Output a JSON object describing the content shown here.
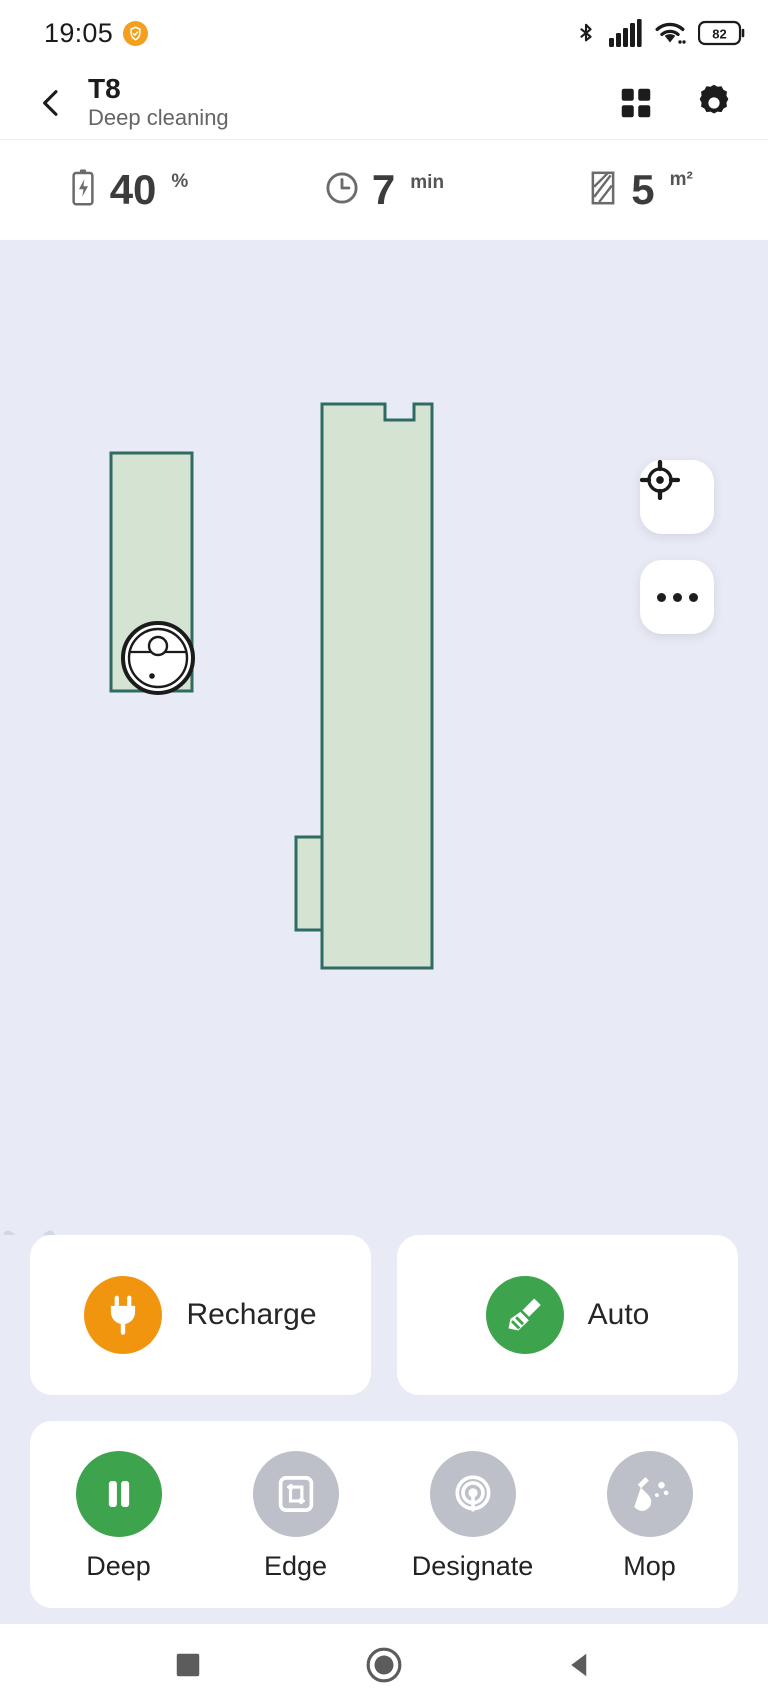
{
  "status_bar": {
    "time": "19:05",
    "badge_icon": "shield-check-icon",
    "bluetooth_icon": "bluetooth-icon",
    "signal_icon": "cellular-signal-icon",
    "wifi_icon": "wifi-icon",
    "battery_level": "82"
  },
  "app_bar": {
    "back_icon": "back-chevron-icon",
    "title": "T8",
    "subtitle": "Deep cleaning",
    "grid_icon": "grid-menu-icon",
    "settings_icon": "gear-icon"
  },
  "stats": [
    {
      "icon": "battery-charging-icon",
      "value": "40",
      "unit": "%"
    },
    {
      "icon": "clock-icon",
      "value": "7",
      "unit": "min"
    },
    {
      "icon": "area-icon",
      "value": "5",
      "unit": "m²"
    }
  ],
  "map": {
    "background_color": "#e8ebf5",
    "room_fill": "#d5e3d2",
    "room_stroke": "#2e6b63",
    "robot_icon": "robot-vacuum-icon",
    "locate_button": "locate-target-icon",
    "more_button": "more-options-icon",
    "collapse_handle": "chevron-down-icon"
  },
  "actions": [
    {
      "label": "Recharge",
      "icon": "plug-icon",
      "color": "#f2950e"
    },
    {
      "label": "Auto",
      "icon": "broom-icon",
      "color": "#3da34d"
    }
  ],
  "modes": [
    {
      "label": "Deep",
      "icon": "pause-icon",
      "active": true,
      "color": "#3da34d"
    },
    {
      "label": "Edge",
      "icon": "edge-icon",
      "active": false,
      "color": "#bdc0c9"
    },
    {
      "label": "Designate",
      "icon": "designate-icon",
      "active": false,
      "color": "#bdc0c9"
    },
    {
      "label": "Mop",
      "icon": "mop-icon",
      "active": false,
      "color": "#bdc0c9"
    }
  ],
  "nav_bar": {
    "recents_icon": "square-recents-icon",
    "home_icon": "circle-home-icon",
    "back_icon": "triangle-back-icon"
  }
}
